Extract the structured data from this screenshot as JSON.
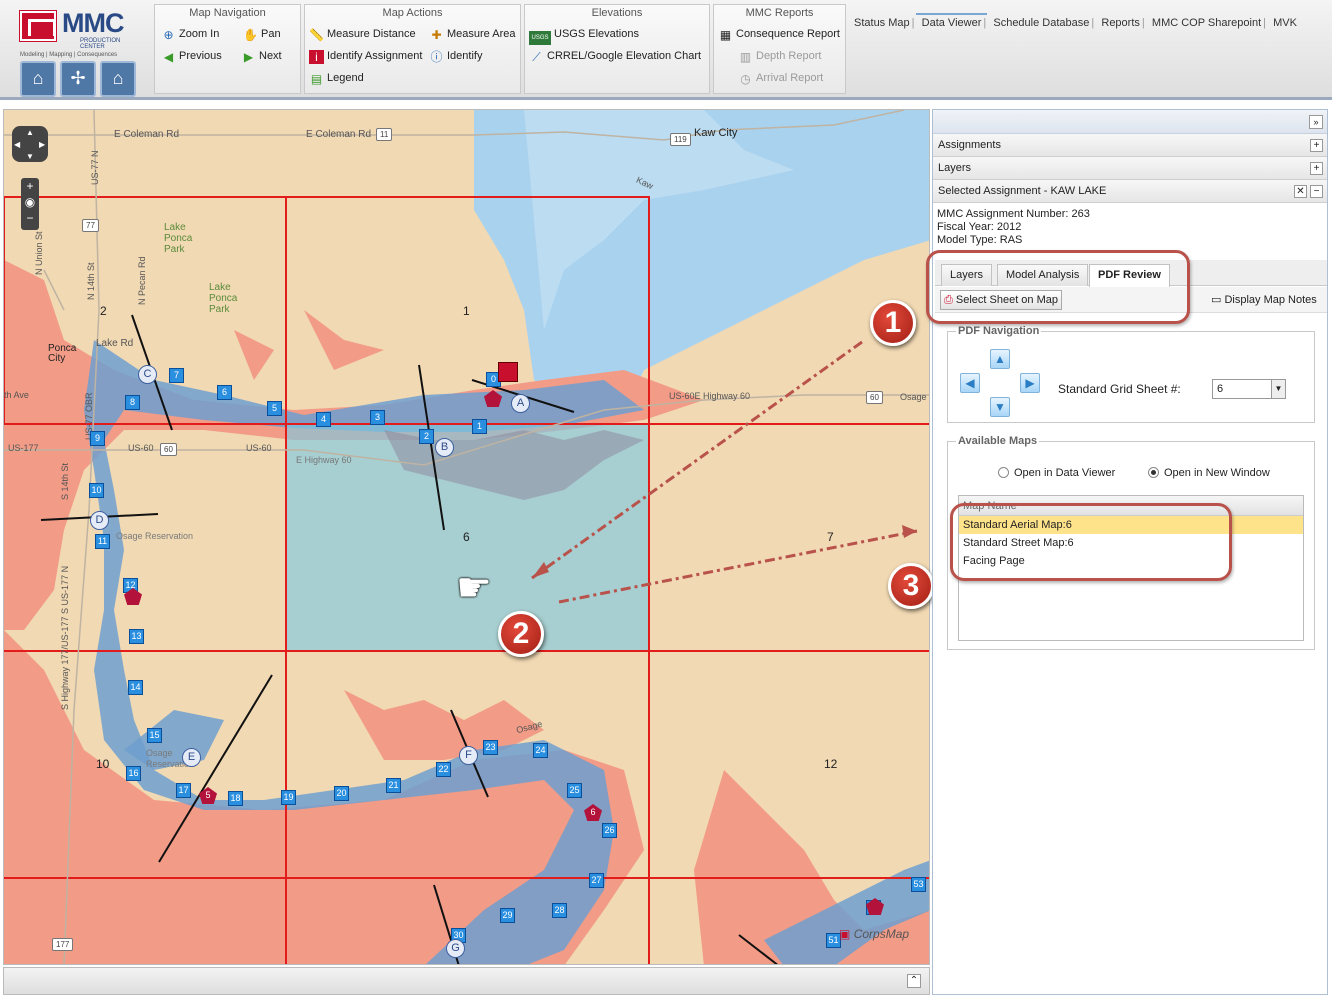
{
  "logo": {
    "title": "MMC",
    "subtitle": "PRODUCTION CENTER",
    "tagline": "Modeling | Mapping | Consequences",
    "buttons": [
      "levee-icon",
      "grid-icon",
      "house-icon"
    ]
  },
  "toolbar": {
    "map_navigation": {
      "title": "Map Navigation",
      "zoom_in": "Zoom In",
      "pan": "Pan",
      "previous": "Previous",
      "next": "Next"
    },
    "map_actions": {
      "title": "Map Actions",
      "measure_distance": "Measure Distance",
      "measure_area": "Measure Area",
      "identify_assignment": "Identify Assignment",
      "identify": "Identify",
      "legend": "Legend"
    },
    "elevations": {
      "title": "Elevations",
      "usgs": "USGS Elevations",
      "crrel": "CRREL/Google Elevation Chart"
    },
    "mmc_reports": {
      "title": "MMC Reports",
      "consequence": "Consequence Report",
      "depth": "Depth Report",
      "arrival": "Arrival Report"
    }
  },
  "topnav": [
    "Status Map",
    "Data Viewer",
    "Schedule Database",
    "Reports",
    "MMC COP Sharepoint",
    "MVK"
  ],
  "map": {
    "roads": {
      "e_coleman_w": "E Coleman Rd",
      "e_coleman_e": "E Coleman Rd",
      "kaw_city": "Kaw City",
      "osage_e": "Osage",
      "ponca_city": "Ponca City",
      "lake_rd": "Lake Rd",
      "lake_ponca_park_1": "Lake Ponca Park",
      "lake_ponca_park_2": "Lake Ponca Park",
      "us60_label": "US-60",
      "us60e": "US-60E Highway 60",
      "us177": "US-177",
      "us60_w": "US-60",
      "e_highway_60": "E Highway 60",
      "osage_reservation": "Osage Reservation",
      "th_ave": "th Ave",
      "n_union": "N Union St",
      "n_14th": "N 14th St",
      "n_pecan": "N Pecan Rd",
      "us77_n": "US-77 N",
      "us77_obr": "US-77 OBR",
      "s_14th": "S 14th St",
      "s_hwy177": "S Highway 177/US-177 S US-177 N",
      "osage_res2": "Osage Reservation",
      "kaw": "Kaw",
      "osage_river": "Osage"
    },
    "shields": [
      "11",
      "119",
      "77",
      "60",
      "60",
      "177"
    ],
    "sheet_numbers": [
      "1",
      "2",
      "6",
      "7",
      "10",
      "12"
    ],
    "grid_points": [
      "0",
      "1",
      "2",
      "3",
      "4",
      "5",
      "6",
      "7",
      "8",
      "9",
      "10",
      "11",
      "12",
      "13",
      "14",
      "15",
      "16",
      "17",
      "18",
      "19",
      "20",
      "21",
      "22",
      "23",
      "24",
      "25",
      "26",
      "27",
      "28",
      "29",
      "30",
      "51",
      "52",
      "53"
    ],
    "hex_markers": [
      "A",
      "B",
      "C",
      "D",
      "E",
      "F",
      "G"
    ],
    "pentagons": [
      "5",
      "6"
    ],
    "badges": [
      "1",
      "2",
      "3"
    ],
    "watermark": "CorpsMap"
  },
  "panel": {
    "assignments": "Assignments",
    "layers": "Layers",
    "selected": "Selected Assignment - KAW LAKE",
    "info": {
      "number": "MMC Assignment Number: 263",
      "fiscal": "Fiscal Year: 2012",
      "model": "Model Type: RAS"
    },
    "tabs": [
      "Layers",
      "Model Analysis",
      "PDF Review"
    ],
    "select_sheet": "Select Sheet on Map",
    "display_notes": "Display Map Notes",
    "pdf_navigation": "PDF Navigation",
    "grid_sheet_label": "Standard Grid Sheet #:",
    "grid_sheet_value": "6",
    "available_maps": "Available Maps",
    "open_data_viewer": "Open in Data Viewer",
    "open_new_window": "Open in New Window",
    "map_name_header": "Map Name",
    "maps": [
      "Standard Aerial Map:6",
      "Standard Street Map:6",
      "Facing Page"
    ]
  },
  "colors": {
    "water": "#a9d2ee",
    "flood": "#f29b87",
    "land": "#f1d9b3",
    "grid_line": "#e21b1b",
    "selected_sheet": "#7fc8e0",
    "callout": "#b8524a"
  }
}
